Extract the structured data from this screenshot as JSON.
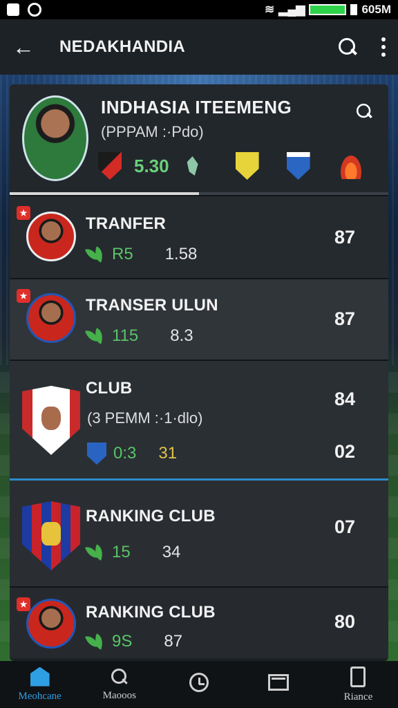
{
  "status_bar": {
    "time": "605M"
  },
  "app_bar": {
    "title": "NEDAKHANDIA"
  },
  "header": {
    "title": "INDHASIA ITEEMENG",
    "subtitle": "(PPPAM :·Pdo)",
    "score": "5.30",
    "progress": 0.5
  },
  "rows": [
    {
      "tag": "★",
      "title": "TRANFER",
      "stat_green": "R5",
      "stat_plain": "1.58",
      "rating": "87"
    },
    {
      "tag": "★",
      "title": "TRANSER ULUN",
      "stat_green": "115",
      "stat_plain": "8.3",
      "rating": "87"
    },
    {
      "title": "CLUB",
      "subtitle": "(3 PEMM :·1·dlo)",
      "rating_top": "84",
      "stat_green": "0:3",
      "stat_gold": "31",
      "rating_bottom": "02"
    },
    {
      "title": "RANKING CLUB",
      "stat_green": "15",
      "stat_plain": "34",
      "rating": "07"
    },
    {
      "tag": "★",
      "title": "RANKING CLUB",
      "stat_green": "9S",
      "stat_plain": "87",
      "rating": "80"
    }
  ],
  "bottom_nav": [
    {
      "label": "Meohcane",
      "icon": "home-icon"
    },
    {
      "label": "Maooos",
      "icon": "search-icon"
    },
    {
      "label": "",
      "icon": "clock-icon"
    },
    {
      "label": "",
      "icon": "mail-icon"
    },
    {
      "label": "Riance",
      "icon": "phone-icon"
    }
  ],
  "colors": {
    "accent": "#2f9fe4",
    "green": "#59c565",
    "gold": "#e2c24c"
  }
}
